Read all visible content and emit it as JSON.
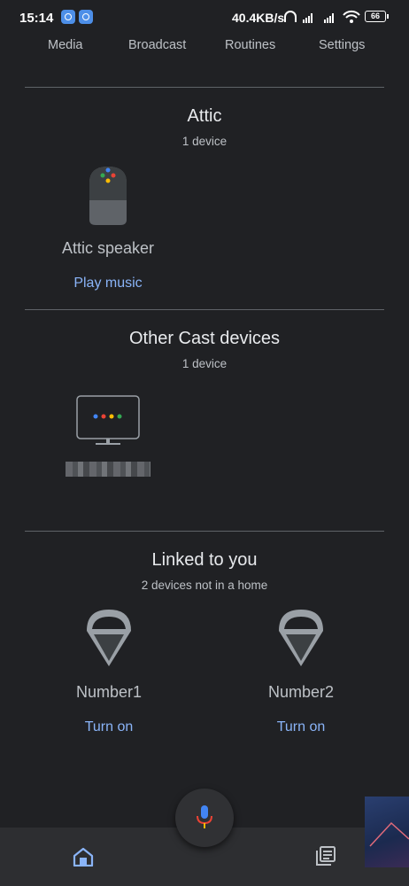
{
  "status_bar": {
    "time": "15:14",
    "network_speed": "40.4KB/s",
    "battery": "66"
  },
  "tabs": [
    {
      "label": "Media"
    },
    {
      "label": "Broadcast"
    },
    {
      "label": "Routines"
    },
    {
      "label": "Settings"
    }
  ],
  "sections": {
    "attic": {
      "title": "Attic",
      "subtitle": "1 device",
      "device_name": "Attic speaker",
      "action": "Play music"
    },
    "other_cast": {
      "title": "Other Cast devices",
      "subtitle": "1 device"
    },
    "linked": {
      "title": "Linked to you",
      "subtitle": "2 devices not in a home",
      "devices": [
        {
          "name": "Number1",
          "action": "Turn on"
        },
        {
          "name": "Number2",
          "action": "Turn on"
        }
      ]
    }
  },
  "colors": {
    "background": "#202124",
    "accent": "#8ab4f8",
    "google_blue": "#4285f4",
    "google_red": "#ea4335",
    "google_yellow": "#fbbc04",
    "google_green": "#34a853"
  },
  "icons": {
    "home_nav": "home-icon",
    "feed_nav": "feed-icon",
    "mic": "mic-icon"
  }
}
